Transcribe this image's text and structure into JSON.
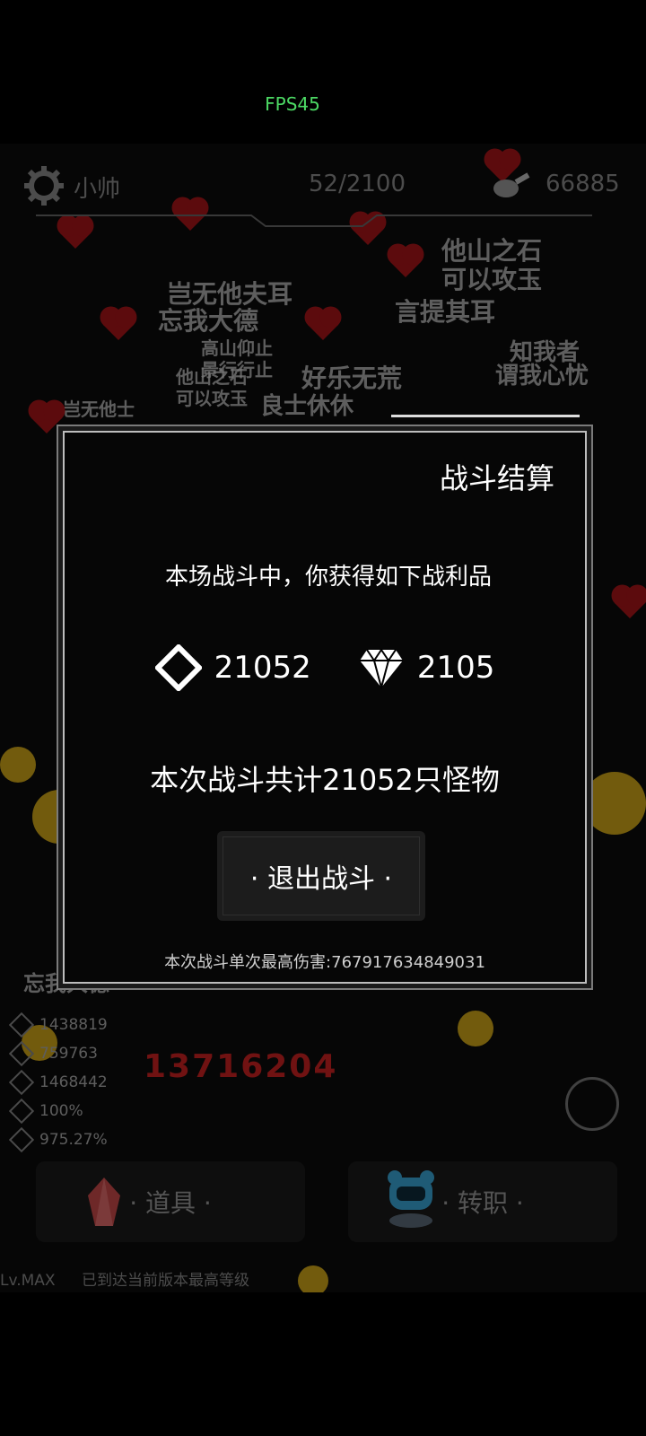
{
  "fps": "FPS45",
  "topbar": {
    "player_name": "小帅",
    "progress": "52/2100",
    "score": "66885",
    "settings_icon": "gear-icon",
    "resource_icon": "meat-icon"
  },
  "background_texts": [
    "岂无他夫耳",
    "忘我大德",
    "他山之石",
    "可以攻玉",
    "言提其耳",
    "高山仰止",
    "景行行止",
    "好乐无荒",
    "他山之石",
    "可以攻玉",
    "知我者",
    "谓我心忧",
    "岂无他士",
    "良士休休"
  ],
  "stats": [
    "1438819",
    "759763",
    "1468442",
    "100%",
    "975.27%"
  ],
  "bottom_damage": "13716204",
  "bottom_name_tag": "忘我大德",
  "buttons": {
    "items": "· 道具 ·",
    "job_change": "· 转职 ·"
  },
  "level": {
    "lv": "Lv.MAX",
    "note": "已到达当前版本最高等级"
  },
  "modal": {
    "title": "战斗结算",
    "intro": "本场战斗中，你获得如下战利品",
    "rewards": [
      {
        "icon": "diamond-outline-icon",
        "value": "21052"
      },
      {
        "icon": "gem-icon",
        "value": "2105"
      }
    ],
    "kill_count": "本次战斗共计21052只怪物",
    "exit_button": "· 退出战斗 ·",
    "max_damage": "本次战斗单次最高伤害:767917634849031"
  },
  "colors": {
    "fps": "#4cd964",
    "heart": "#c4161c",
    "accent_text": "#ffffff"
  }
}
